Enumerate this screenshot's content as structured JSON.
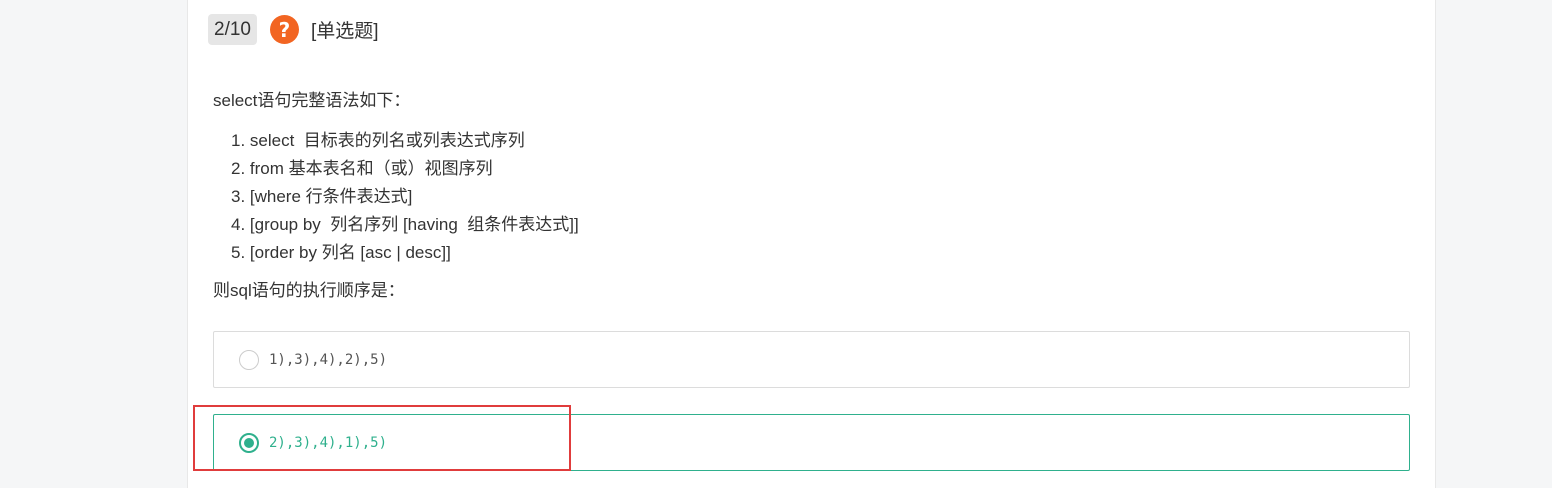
{
  "question": {
    "number": "2/10",
    "help_icon": "question-mark-icon",
    "type_label": "[单选题]",
    "stem_intro": "select语句完整语法如下：",
    "stem_items": [
      "1. select  目标表的列名或列表达式序列",
      "2. from 基本表名和（或）视图序列",
      "3. [where 行条件表达式]",
      "4. [group by  列名序列 [having  组条件表达式]]",
      "5. [order by 列名 [asc | desc]]"
    ],
    "stem_outro": "则sql语句的执行顺序是：",
    "options": [
      {
        "text": "1),3),4),2),5)",
        "selected": false
      },
      {
        "text": "2),3),4),1),5)",
        "selected": true
      }
    ]
  },
  "colors": {
    "accent": "#2fb08d",
    "help_icon": "#f26522",
    "highlight": "#e03c3c"
  }
}
